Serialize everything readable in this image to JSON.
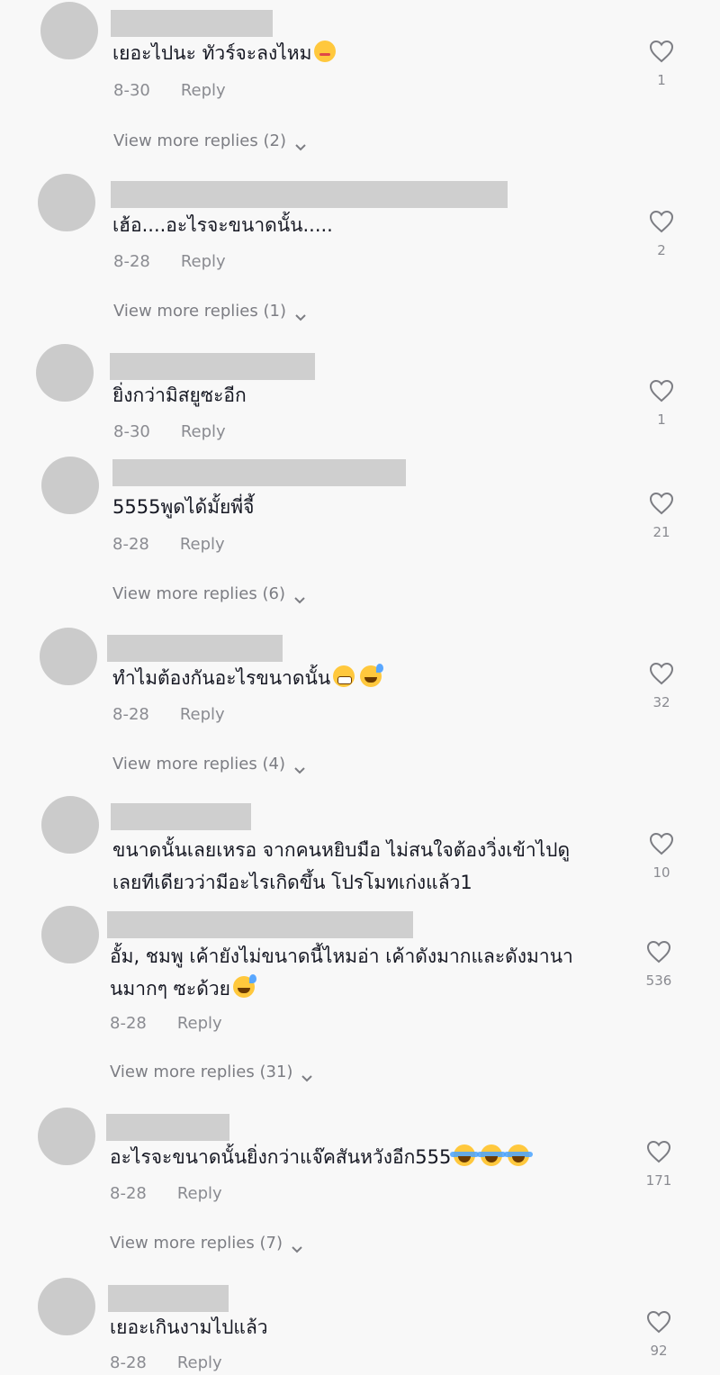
{
  "reply_label": "Reply",
  "comments": [
    {
      "text": "เยอะไปนะ ทัวร์จะลงไหม",
      "emojis": [
        "blush"
      ],
      "date": "8-30",
      "likes": "1",
      "more": "View more replies (2)"
    },
    {
      "text": "เฮ้อ....อะไรจะขนาดนั้น.....",
      "emojis": [],
      "date": "8-28",
      "likes": "2",
      "more": "View more replies (1)"
    },
    {
      "text": "ยิ่งกว่ามิสยูซะอีก",
      "emojis": [],
      "date": "8-30",
      "likes": "1",
      "more": ""
    },
    {
      "text": "5555พูดได้มั้ยพี่จี้",
      "emojis": [],
      "date": "8-28",
      "likes": "21",
      "more": "View more replies (6)"
    },
    {
      "text": "ทำไมต้องกันอะไรขนาดนั้น",
      "emojis": [
        "grin",
        "sweat"
      ],
      "date": "8-28",
      "likes": "32",
      "more": "View more replies (4)"
    },
    {
      "text": "ขนาดนั้นเลยเหรอ จากคนหยิบมือ ไม่สนใจต้องวิ่งเข้าไปดู",
      "text2": "เลยทีเดียวว่ามีอะไรเกิดขึ้น โปรโมทเก่งแล้ว1",
      "emojis": [],
      "date": "",
      "likes": "10",
      "more": ""
    },
    {
      "text": "อั้ม, ชมพู เค้ายังไม่ขนาดนี้ไหมอ่า เค้าดังมากและดังมานา",
      "text2": "นมากๆ ซะด้วย",
      "emojis2": [
        "sweat"
      ],
      "date": "8-28",
      "likes": "536",
      "more": "View more replies (31)"
    },
    {
      "text": "อะไรจะขนาดนั้นยิ่งกว่าแจ๊คสันหวังอีก555",
      "emojis": [
        "joy",
        "joy",
        "joy"
      ],
      "date": "8-28",
      "likes": "171",
      "more": "View more replies (7)"
    },
    {
      "text": "เยอะเกินงามไปแล้ว",
      "emojis": [],
      "date": "8-28",
      "likes": "92",
      "more": ""
    }
  ]
}
